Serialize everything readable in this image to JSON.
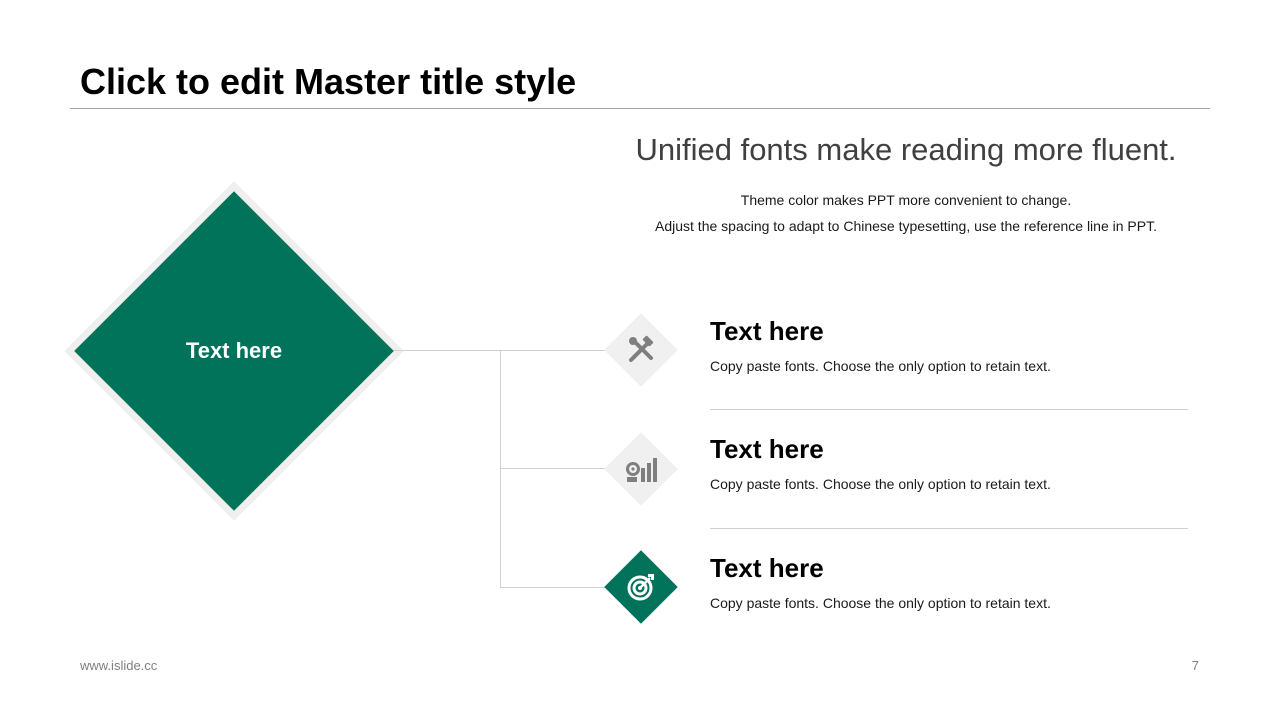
{
  "slide": {
    "title": "Click to edit Master title style",
    "subtitle": "Unified fonts make reading more fluent.",
    "description_lines": [
      "Theme color makes PPT more convenient  to change.",
      "Adjust  the  spacing  to adapt to Chinese  typesetting,  use the reference line  in PPT."
    ]
  },
  "center_label": "Text here",
  "items": [
    {
      "title": "Text here",
      "body": "Copy paste fonts. Choose the only  option to retain text.",
      "icon": "tools-icon",
      "highlighted": false
    },
    {
      "title": "Text here",
      "body": "Copy paste fonts. Choose the only  option to retain text.",
      "icon": "gear-chart-icon",
      "highlighted": false
    },
    {
      "title": "Text here",
      "body": "Copy paste fonts. Choose the only  option to retain text.",
      "icon": "target-icon",
      "highlighted": true
    }
  ],
  "footer": {
    "url": "www.islide.cc",
    "page_number": "7"
  },
  "colors": {
    "accent": "#00735a",
    "icon_gray": "#7f7f7f"
  }
}
